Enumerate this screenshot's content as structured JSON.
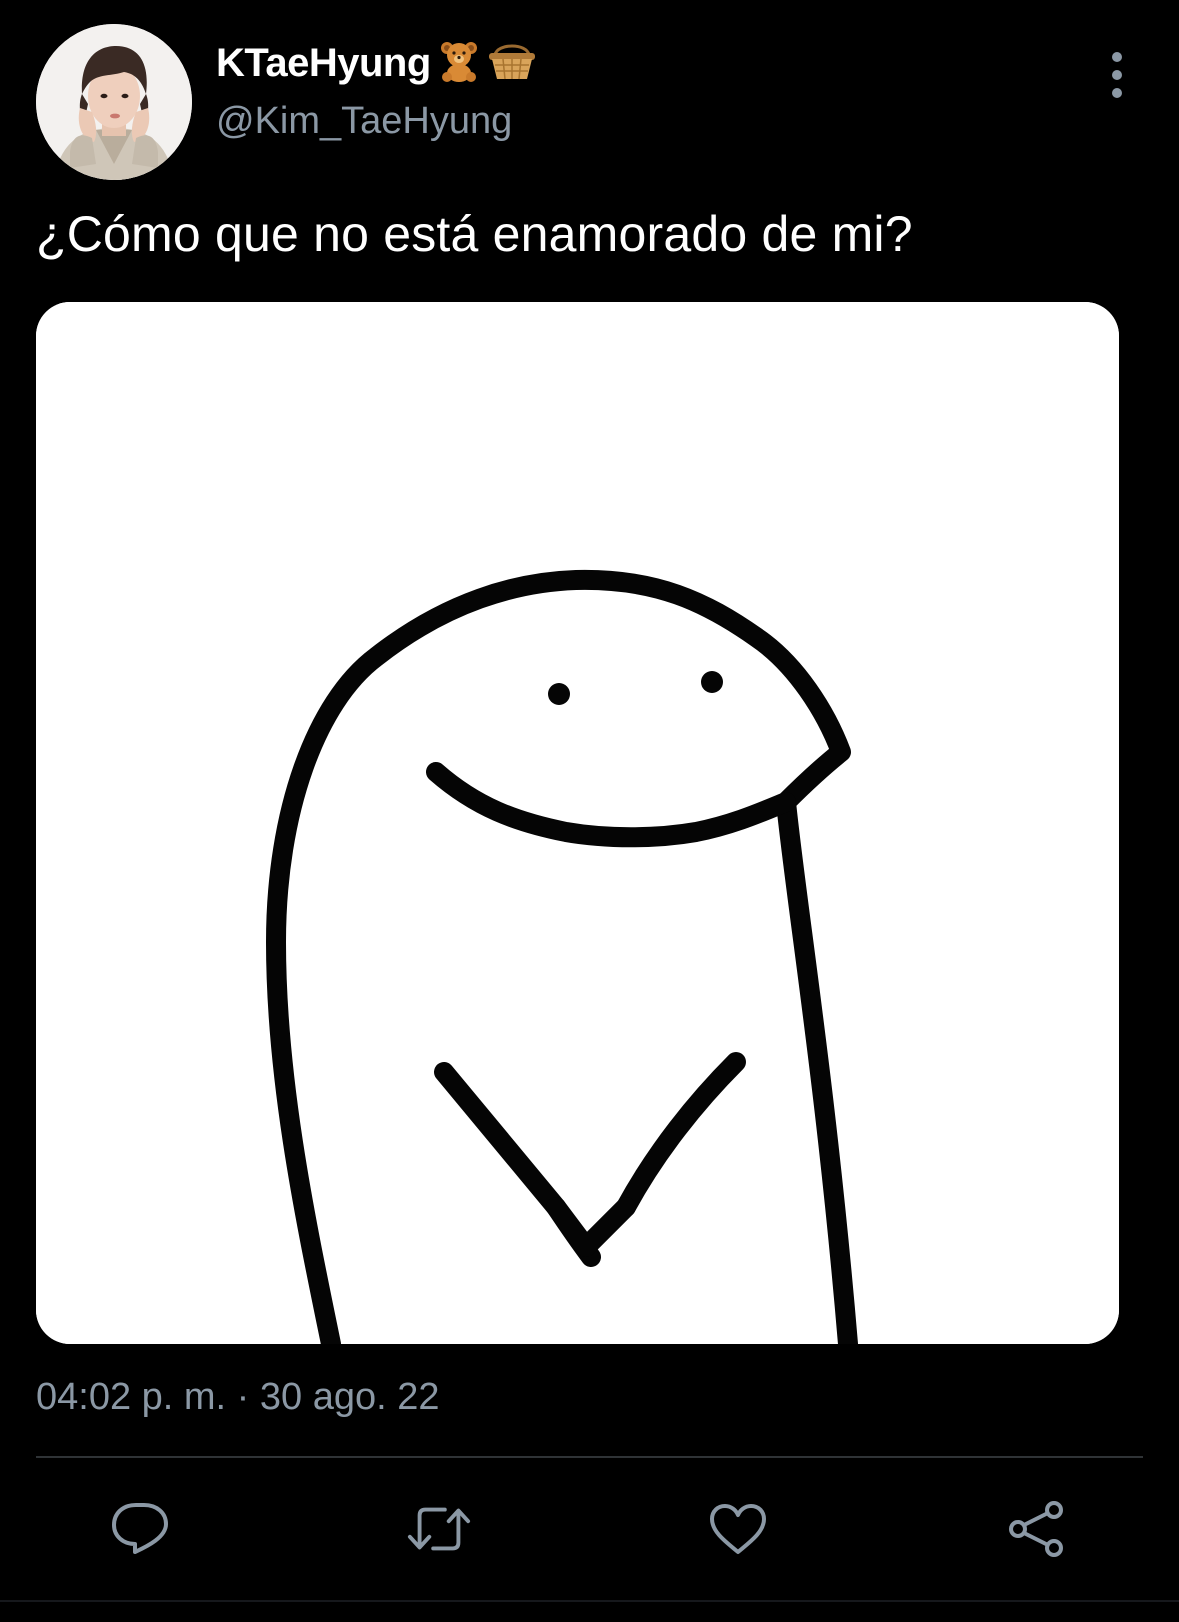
{
  "tweet": {
    "display_name": "KTaeHyung",
    "name_emojis": [
      "teddy-bear-emoji",
      "basket-emoji"
    ],
    "handle": "@Kim_TaeHyung",
    "text": "¿Cómo que no está enamorado de mi?",
    "timestamp": "04:02 p. m. · 30 ago. 22",
    "media": {
      "icon": "flork-meme-image"
    }
  },
  "actions": {
    "reply_icon": "reply-icon",
    "retweet_icon": "retweet-icon",
    "like_icon": "heart-icon",
    "share_icon": "share-icon"
  },
  "colors": {
    "background": "#000000",
    "primary_text": "#ffffff",
    "secondary_text": "#8b98a5",
    "divider": "#2f3336"
  }
}
